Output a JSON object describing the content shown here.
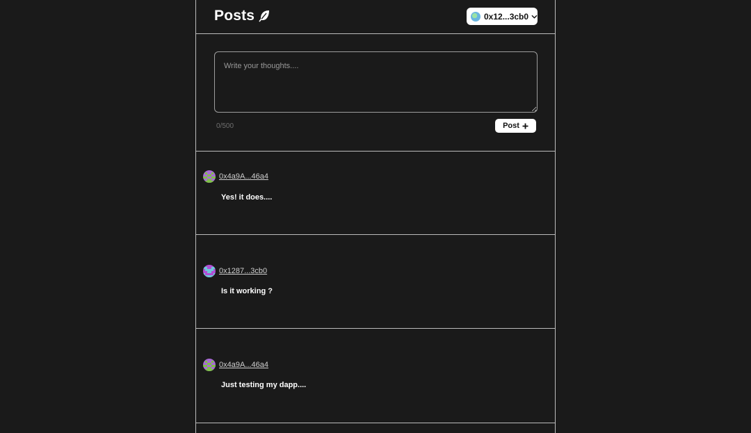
{
  "header": {
    "title": "Posts",
    "title_icon": "feather-icon",
    "wallet": {
      "address": "0x12...3cb0",
      "avatar_icon": "wallet-avatar-icon",
      "chevron_icon": "chevron-down-icon"
    }
  },
  "composer": {
    "placeholder": "Write your thoughts....",
    "value": "",
    "counter": "0/500",
    "post_label": "Post",
    "post_icon": "plus-icon"
  },
  "posts": [
    {
      "author": "0x4a9A...46a4",
      "text": "Yes! it does....",
      "avatar_colors": [
        "#7fbf4a",
        "#a86bd4"
      ]
    },
    {
      "author": "0x1287...3cb0",
      "text": "Is it working ?",
      "avatar_colors": [
        "#b24fd6",
        "#6fc7d9"
      ]
    },
    {
      "author": "0x4a9A...46a4",
      "text": "Just testing my dapp....",
      "avatar_colors": [
        "#7fbf4a",
        "#a86bd4"
      ]
    }
  ],
  "colors": {
    "background": "#1a1a1a",
    "border": "#bdbdbd",
    "button_bg": "#ffffff",
    "link": "#cfcfcf"
  }
}
